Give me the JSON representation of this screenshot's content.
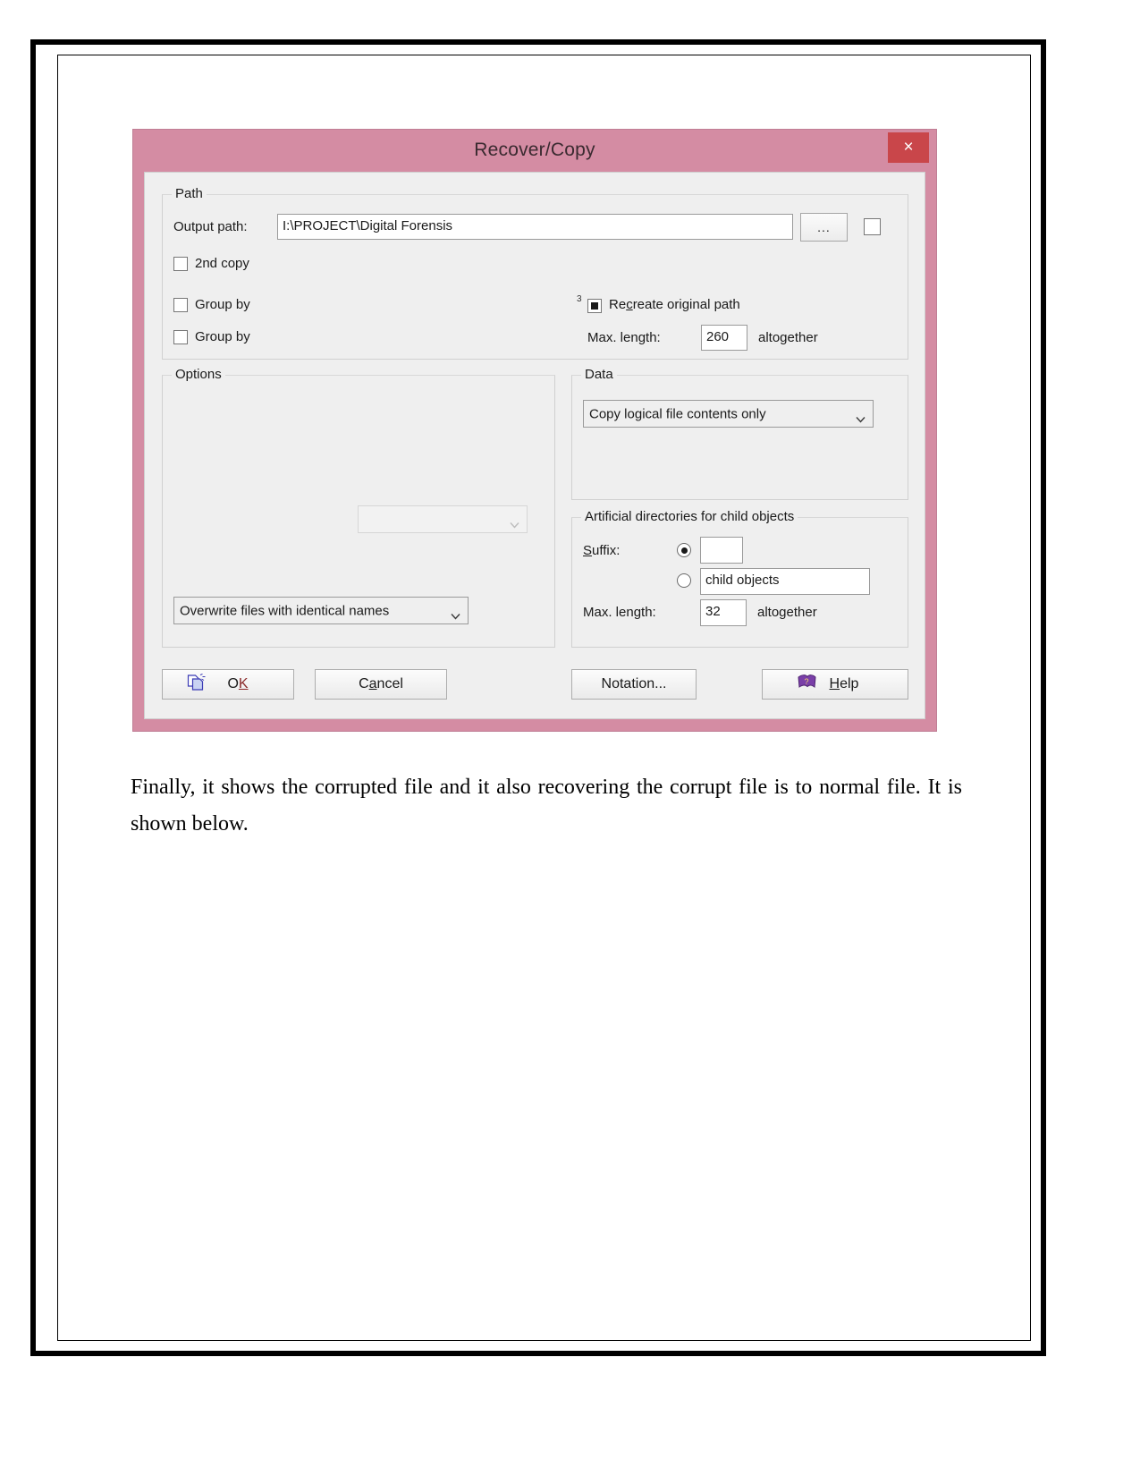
{
  "document": {
    "paragraph": "Finally, it shows the corrupted file and it also recovering the corrupt file is to normal file. It is shown below."
  },
  "dialog": {
    "title": "Recover/Copy",
    "close_label": "×",
    "accent_titlebar": "#d48ca3",
    "accent_close": "#c9464a",
    "path_group": {
      "legend": "Path",
      "output_path_label": "Output path:",
      "output_path_value": "I:\\PROJECT\\Digital Forensis",
      "browse_label": "...",
      "second_copy_label": "2nd copy",
      "group_by_1_label": "Group by",
      "group_by_2_label": "Group by",
      "recreate_superscript": "3",
      "recreate_label_pre": "Re",
      "recreate_label_key": "c",
      "recreate_label_post": "reate original path",
      "max_length_label": "Max. length:",
      "max_length_value": "260",
      "altogether_label": "altogether"
    },
    "options_group": {
      "legend": "Options",
      "empty_combo_value": "",
      "overwrite_combo_value": "Overwrite files with identical names"
    },
    "data_group": {
      "legend": "Data",
      "combo_value": "Copy logical file contents only"
    },
    "artificial_group": {
      "legend": "Artificial directories for child objects",
      "suffix_label_key": "S",
      "suffix_label_rest": "uffix:",
      "suffix_custom_value": "",
      "suffix_preset_value": "child objects",
      "max_length_label": "Max. length:",
      "max_length_value": "32",
      "altogether_label": "altogether"
    },
    "buttons": {
      "ok": {
        "pre": "O",
        "key": "K",
        "full": "OK"
      },
      "cancel": {
        "pre": "C",
        "key": "a",
        "post": "ncel",
        "full": "Cancel"
      },
      "notation": "Notation...",
      "help": {
        "key": "H",
        "post": "elp",
        "full": "Help"
      }
    }
  }
}
